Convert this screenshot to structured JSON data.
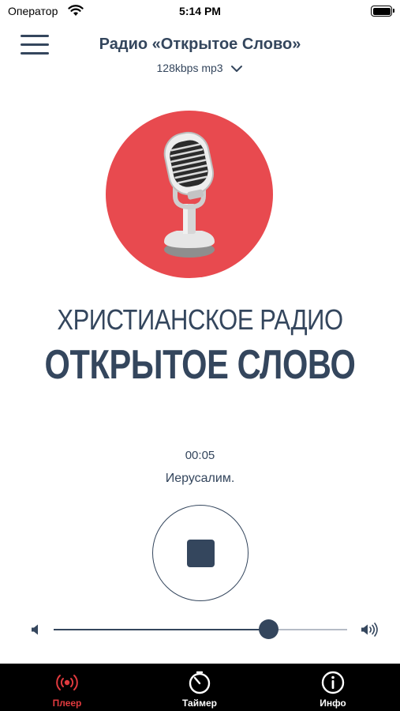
{
  "status_bar": {
    "carrier": "Оператор",
    "time": "5:14 PM",
    "icons": [
      "wifi-icon",
      "battery-icon"
    ]
  },
  "header": {
    "title": "Радио «Открытое Слово»",
    "stream_quality": "128kbps mp3"
  },
  "logo": {
    "background_color": "#e84a4f",
    "icon": "microphone-icon"
  },
  "brand": {
    "line1": "ХРИСТИАНСКОЕ РАДИО",
    "line2": "ОТКРЫТОЕ СЛОВО"
  },
  "player": {
    "elapsed": "00:05",
    "track_title": "Иерусалим.",
    "state": "playing",
    "control_icon": "stop-icon"
  },
  "volume": {
    "level": 0.73
  },
  "tab_bar": {
    "tabs": [
      {
        "label": "Плеер",
        "icon": "broadcast-icon",
        "active": true
      },
      {
        "label": "Таймер",
        "icon": "timer-icon",
        "active": false
      },
      {
        "label": "Инфо",
        "icon": "info-icon",
        "active": false
      }
    ]
  },
  "colors": {
    "primary": "#34465d",
    "accent": "#e84a4f",
    "active_tab": "#e03a3e",
    "tab_bar": "#000000"
  }
}
